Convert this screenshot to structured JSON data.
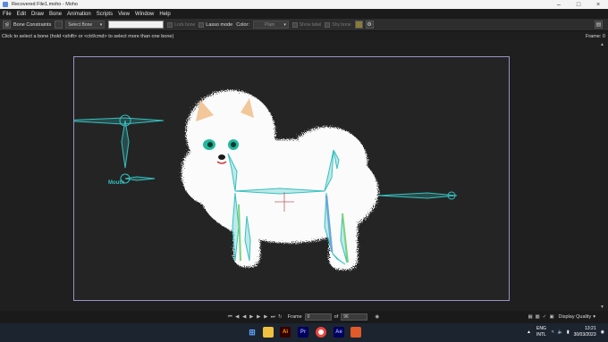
{
  "window": {
    "title": "Recovered File1.moho - Moho"
  },
  "menu": [
    "File",
    "Edit",
    "Draw",
    "Bone",
    "Animation",
    "Scripts",
    "View",
    "Window",
    "Help"
  ],
  "toolbar": {
    "tool_icon": "bone-tool-icon",
    "constraints_label": "Bone Constraints",
    "select_bone": "Select Bone",
    "lock_bone": "Lock bone",
    "lasso_mode": "Lasso mode",
    "color_label": "Color:",
    "color_value": "Plain",
    "show_label": "Show label",
    "shy_bone": "Shy bone"
  },
  "hint": "Click to select a bone (hold <shift> or <ctrl/cmd> to select more than one bone)",
  "frame_readout": "Frame: 0",
  "stage": {
    "bone_label": "Mouth"
  },
  "playback": {
    "frame_label": "Frame",
    "frame_value": "0",
    "of_label": "of",
    "total_value": "96",
    "display_quality": "Display Quality"
  },
  "tray": {
    "lang1": "ENG",
    "lang2": "INTL",
    "time": "13:21",
    "date": "30/03/2023"
  },
  "colors": {
    "bone": "#36c0c0",
    "stage_border": "#9a92c6",
    "canvas": "#242424"
  }
}
